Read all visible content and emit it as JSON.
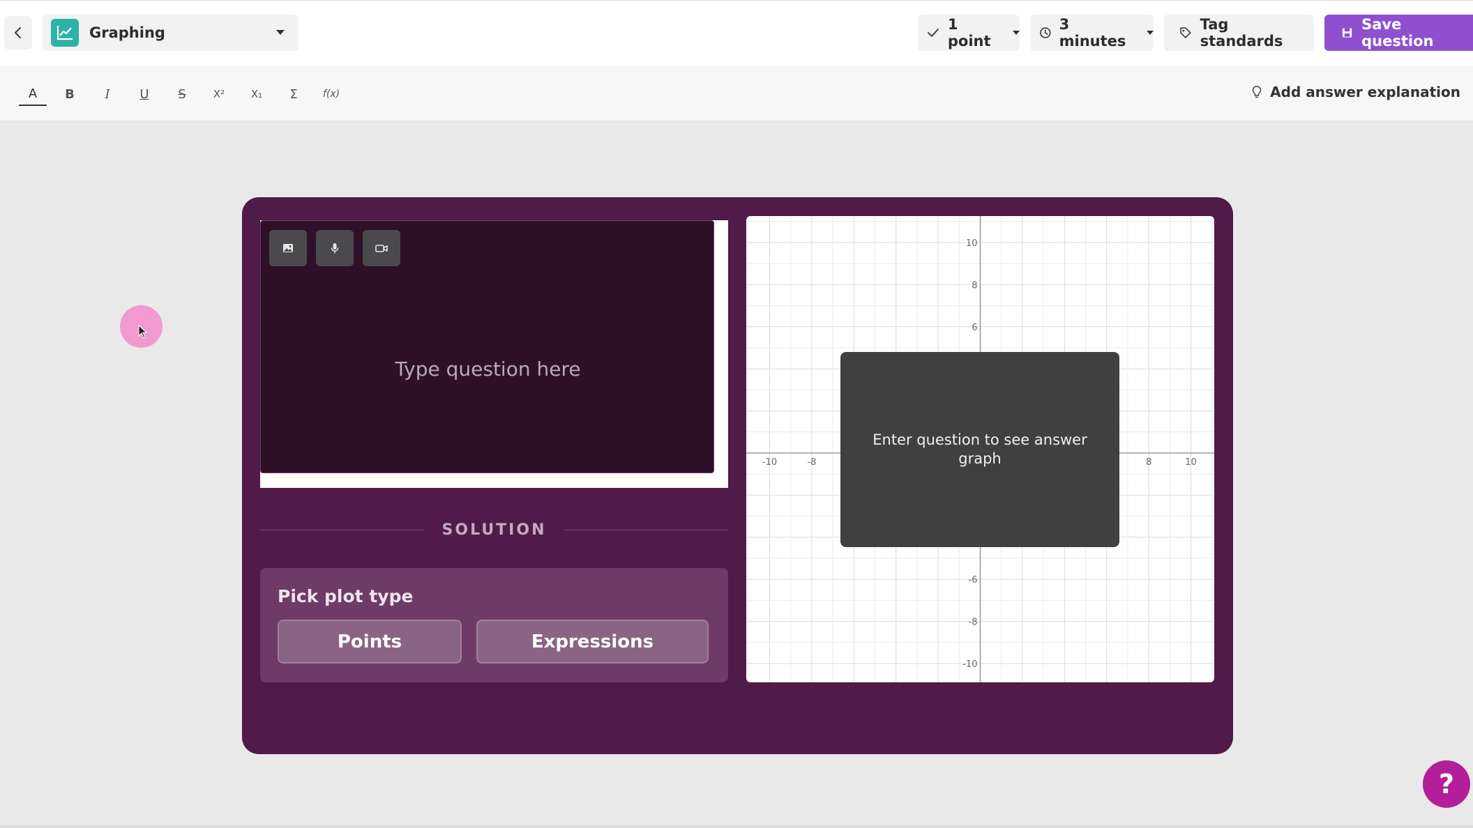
{
  "topbar": {
    "question_type": "Graphing",
    "points": "1 point",
    "time": "3 minutes",
    "tag_label": "Tag standards",
    "save_label": "Save question"
  },
  "format_toolbar": {
    "items": [
      "A",
      "B",
      "I",
      "U",
      "S",
      "X²",
      "X₁",
      "Σ",
      "f(x)"
    ],
    "explanation_label": "Add answer explanation"
  },
  "editor": {
    "placeholder": "Type question here",
    "solution_label": "SOLUTION",
    "plot_type_title": "Pick plot type",
    "plot_types": [
      "Points",
      "Expressions"
    ]
  },
  "graph": {
    "overlay_text": "Enter question to see answer graph",
    "x_ticks": [
      "-10",
      "-8",
      "8",
      "10"
    ],
    "y_ticks": [
      "10",
      "8",
      "6",
      "-6",
      "-8",
      "-10"
    ]
  },
  "help": {
    "label": "?"
  },
  "colors": {
    "accent": "#8f4fcf",
    "card_bg": "#501a49",
    "question_bg": "#2e1029",
    "help": "#b31e99"
  }
}
